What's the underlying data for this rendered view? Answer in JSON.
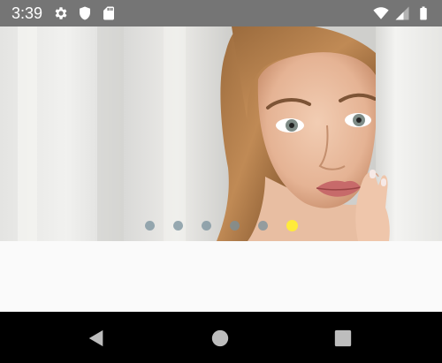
{
  "status_bar": {
    "time": "3:39",
    "left_icons": [
      "gear-icon",
      "shield-icon",
      "sd-card-icon"
    ],
    "right_icons": [
      "wifi-icon",
      "cell-signal-icon",
      "battery-icon"
    ]
  },
  "carousel": {
    "slide_count": 6,
    "active_index": 5,
    "slide_description": "woman-portrait-photo",
    "dot_color": "#78909c",
    "active_dot_color": "#ffeb3b"
  },
  "nav_bar": {
    "buttons": [
      "back-icon",
      "home-icon",
      "recents-icon"
    ]
  },
  "colors": {
    "status_bar": "#757575",
    "nav_bar": "#000000",
    "background": "#fafafa"
  }
}
